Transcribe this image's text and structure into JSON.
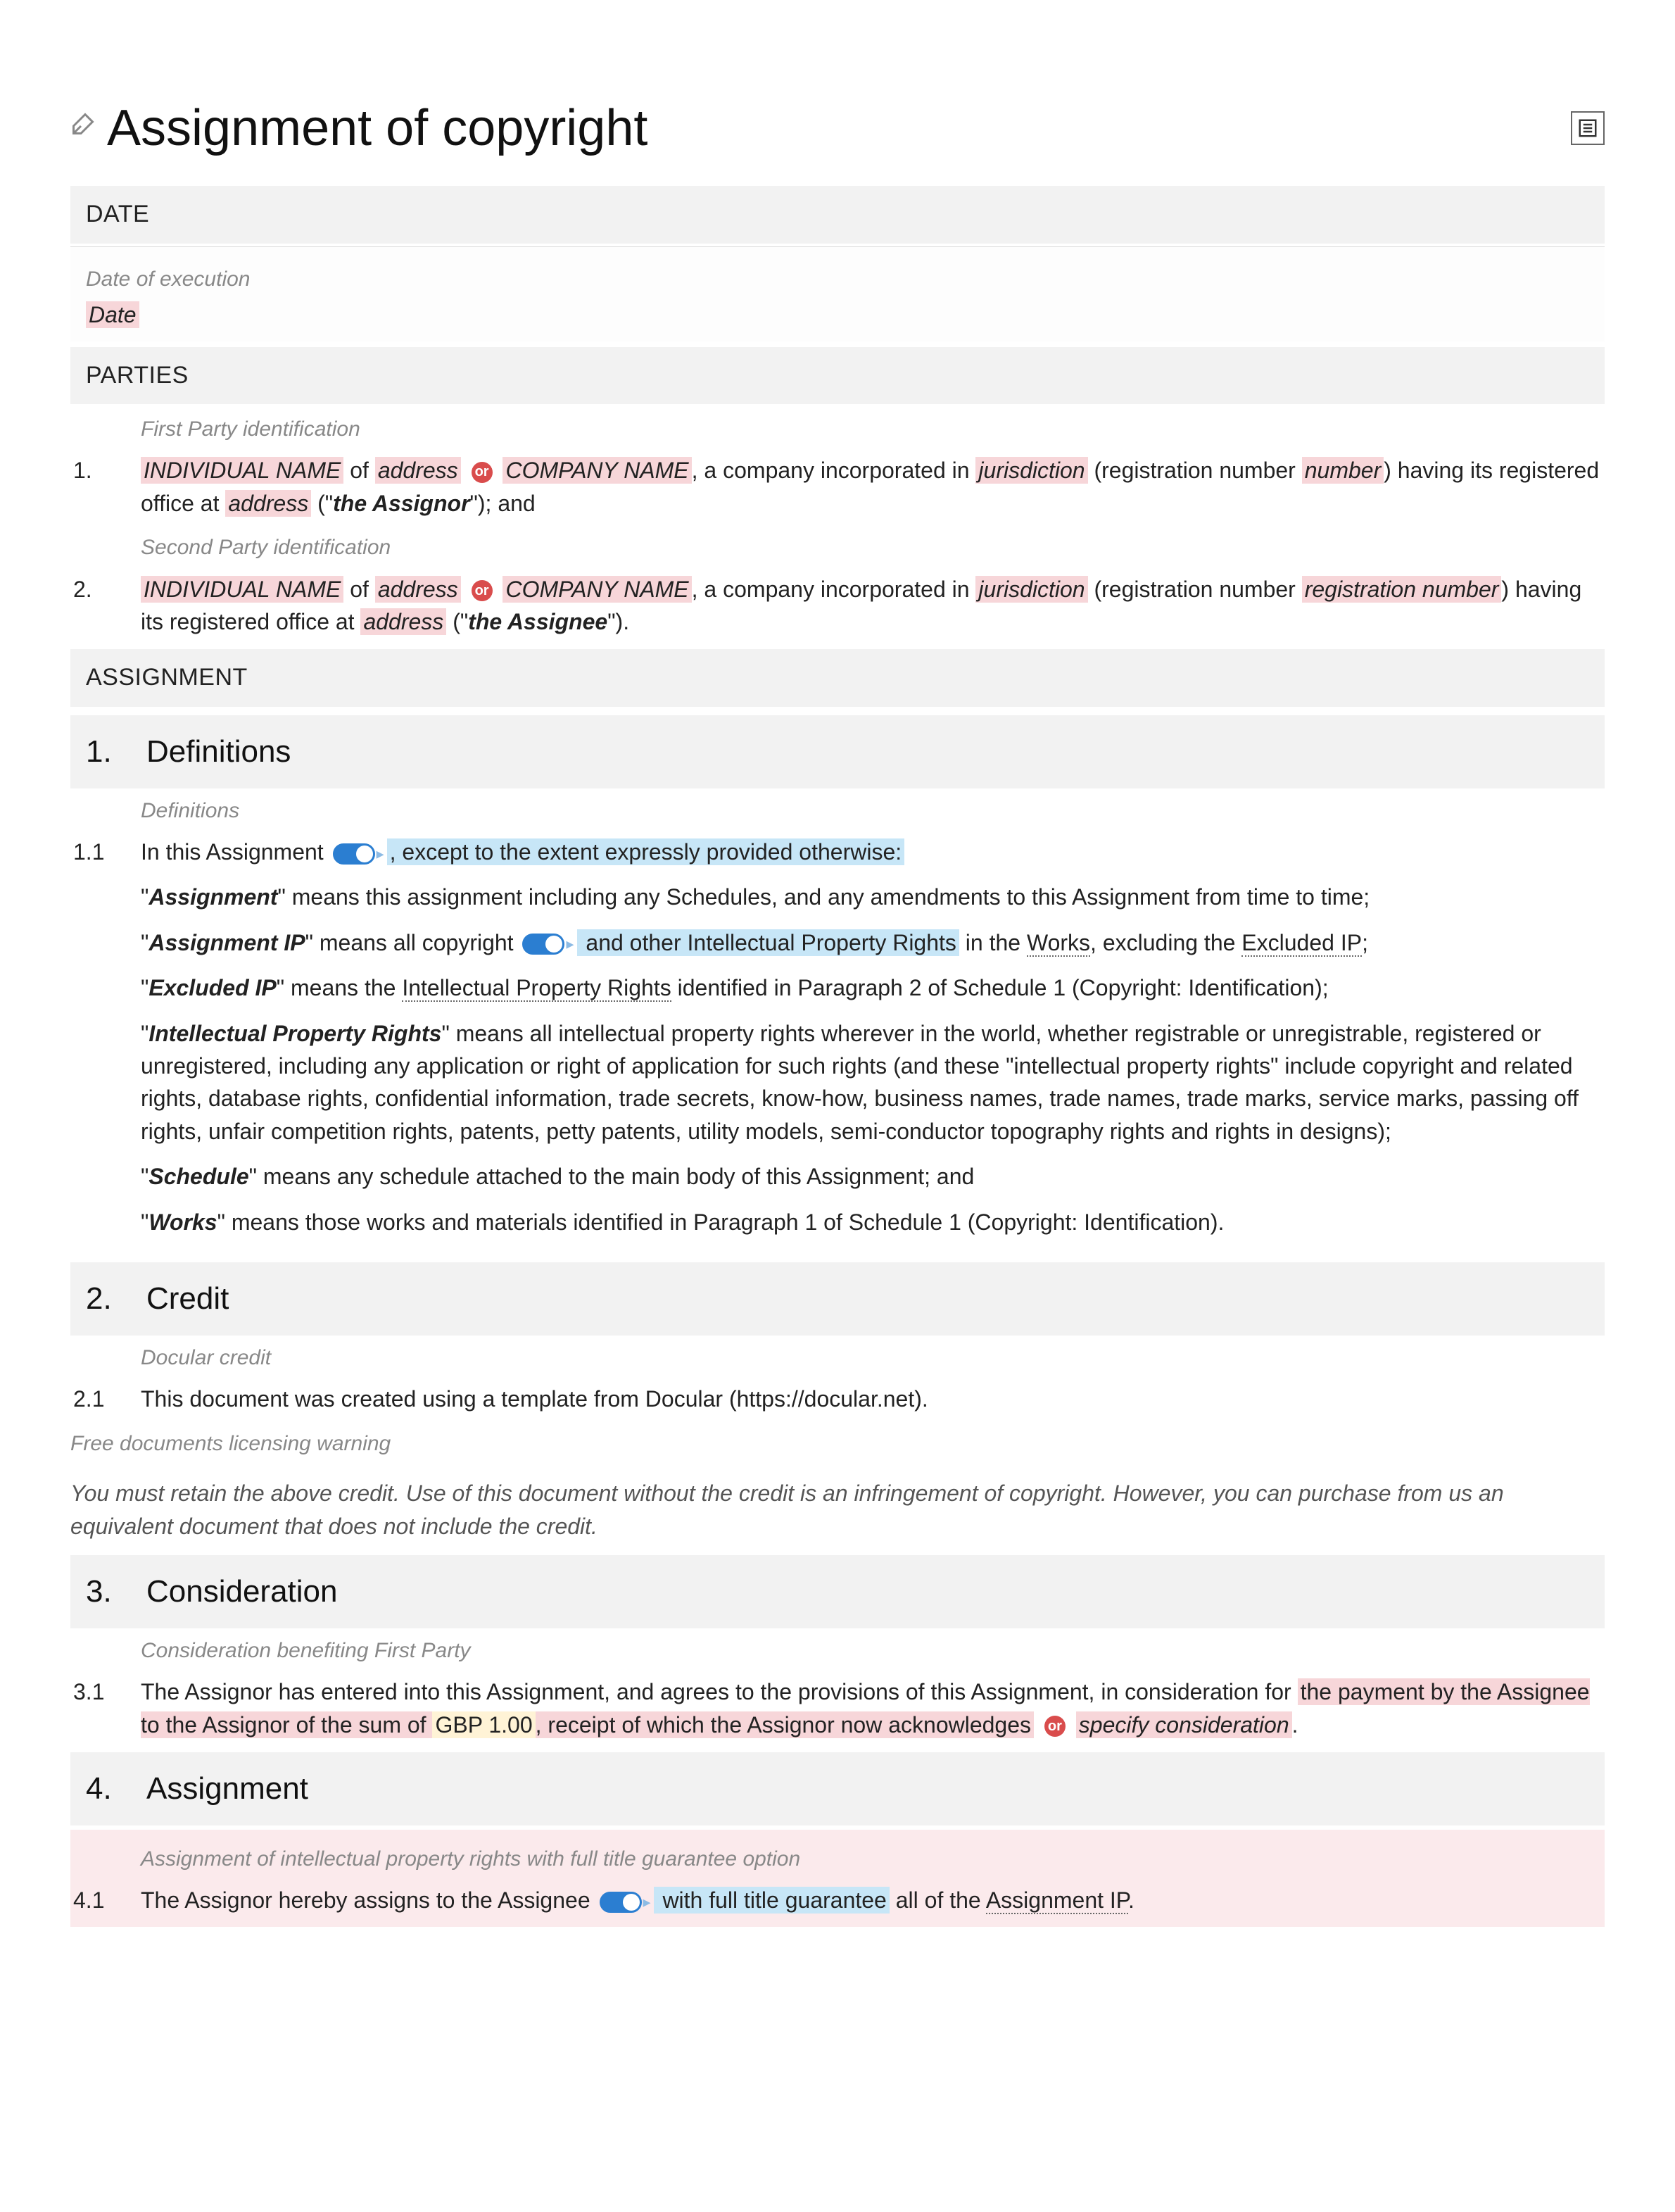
{
  "title": "Assignment of copyright",
  "headers": {
    "date": "DATE",
    "parties": "PARTIES",
    "assignment": "ASSIGNMENT"
  },
  "notes": {
    "dateOfExecution": "Date of execution",
    "firstParty": "First Party identification",
    "secondParty": "Second Party identification",
    "definitions": "Definitions",
    "docularCredit": "Docular credit",
    "freeLicWarn": "Free documents licensing warning",
    "considerationBenefit": "Consideration benefiting First Party",
    "assignmentIpr": "Assignment of intellectual property rights with full title guarantee option"
  },
  "fields": {
    "date": "Date",
    "indivName": "INDIVIDUAL NAME",
    "address": "address",
    "companyName": "COMPANY NAME",
    "jurisdiction": "jurisdiction",
    "number": "number",
    "regNumber": "registration number",
    "gbp": "GBP 1.00",
    "specifyConsideration": "specify consideration"
  },
  "static": {
    "of": " of ",
    "or": "or",
    "companyInc": ", a company incorporated in ",
    "regNumOpen": " (registration number ",
    "regNumClose": ") having its registered office at ",
    "assignorDef": "the Assignor",
    "assigneeDef": "the Assignee",
    "andEnd": "\"); and",
    "periodEnd": "\").",
    "quoteOpen": " (\"",
    "num1": "1.",
    "num2": "2.",
    "num3": "3.",
    "num4": "4.",
    "sub11": "1.1",
    "sub21": "2.1",
    "sub31": "3.1",
    "sub41": "4.1"
  },
  "sections": {
    "definitions": "Definitions",
    "credit": "Credit",
    "consideration": "Consideration",
    "assignmentH": "Assignment"
  },
  "defs": {
    "intro1": "In this Assignment ",
    "intro2": ", except to the extent expressly provided otherwise:",
    "assignment": {
      "term": "Assignment",
      "body": "\" means this assignment including any Schedules, and any amendments to this Assignment from time to time;"
    },
    "assignmentIP": {
      "term": "Assignment IP",
      "body1": "\" means all copyright ",
      "blue": " and other Intellectual Property Rights",
      "body2": " in the ",
      "works": "Works",
      "body3": ", excluding the ",
      "excluded": "Excluded IP",
      "body4": ";"
    },
    "excludedIP": {
      "term": "Excluded IP",
      "body1": "\" means the ",
      "ipr": "Intellectual Property Rights",
      "body2": " identified in Paragraph 2 of Schedule 1 (Copyright: Identification);"
    },
    "ipr": {
      "term": "Intellectual Property Rights",
      "body": "\" means all intellectual property rights wherever in the world, whether registrable or unregistrable, registered or unregistered, including any application or right of application for such rights (and these \"intellectual property rights\" include copyright and related rights, database rights, confidential information, trade secrets, know-how, business names, trade names, trade marks, service marks, passing off rights, unfair competition rights, patents, petty patents, utility models, semi-conductor topography rights and rights in designs);"
    },
    "schedule": {
      "term": "Schedule",
      "body": "\" means any schedule attached to the main body of this Assignment; and"
    },
    "works": {
      "term": "Works",
      "body": "\" means those works and materials identified in Paragraph 1 of Schedule 1 (Copyright: Identification)."
    }
  },
  "credit": {
    "text": "This document was created using a template from Docular (https://docular.net).",
    "warning": "You must retain the above credit. Use of this document without the credit is an infringement of copyright. However, you can purchase from us an equivalent document that does not include the credit."
  },
  "consideration": {
    "p1": "The Assignor has entered into this Assignment, and agrees to the provisions of this Assignment, in consideration for ",
    "p2": "the payment by the Assignee to the Assignor of the sum of ",
    "p3": ", receipt of which the Assignor now acknowledges",
    "period": "."
  },
  "assignClause": {
    "p1": "The Assignor hereby assigns to the Assignee ",
    "blue": " with full title guarantee",
    "p2": " all of the ",
    "aip": "Assignment IP",
    "p3": "."
  }
}
